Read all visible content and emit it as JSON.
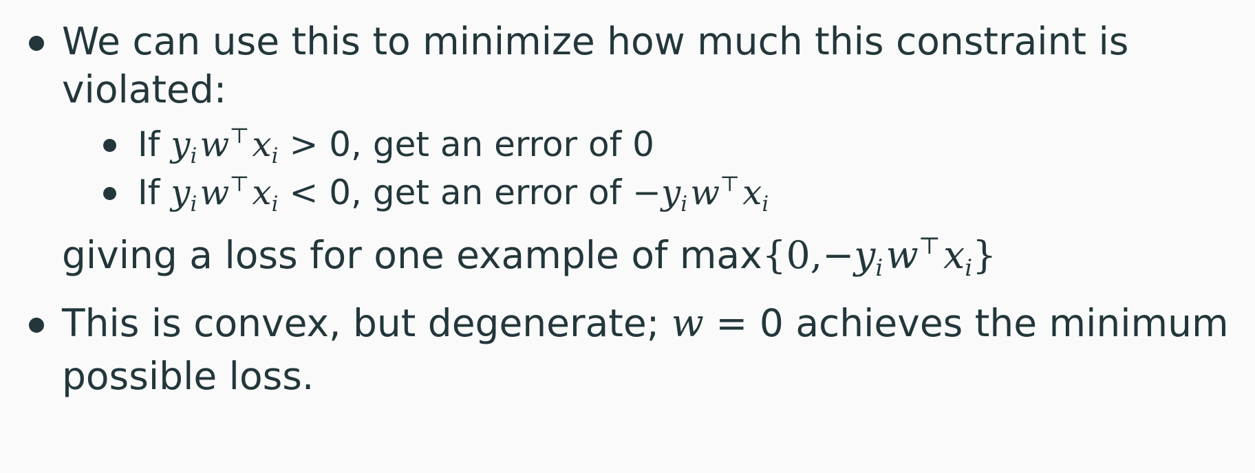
{
  "slide": {
    "bullets": [
      {
        "text_line1": "We can use this to minimize how much this constraint is",
        "text_line2": "violated:"
      }
    ],
    "subbullets": [
      {
        "lead": "If",
        "math_y": "y",
        "math_i1": "i",
        "math_w": "w",
        "math_top": "⊤",
        "math_x": "x",
        "math_i2": "i",
        "op": ">",
        "rest": "0, get an error of 0"
      },
      {
        "lead": "If",
        "math_y": "y",
        "math_i1": "i",
        "math_w": "w",
        "math_top": "⊤",
        "math_x": "x",
        "math_i2": "i",
        "op": "<",
        "rest": "0, get an error of",
        "tail_minus": "−",
        "tail_y": "y",
        "tail_i1": "i",
        "tail_w": "w",
        "tail_top": "⊤",
        "tail_x": "x",
        "tail_i2": "i"
      }
    ],
    "continuation": {
      "text": "giving a loss for one example of max",
      "open": "{",
      "zero": "0,",
      "minus": "−",
      "y": "y",
      "i1": "i",
      "w": "w",
      "top": "⊤",
      "x": "x",
      "i2": "i",
      "close": "}"
    },
    "bullet2": {
      "lead": "This is convex, but degenerate;",
      "w": "w",
      "eq": "=",
      "rest": "0 achieves the minimum",
      "line2": "possible loss."
    }
  }
}
